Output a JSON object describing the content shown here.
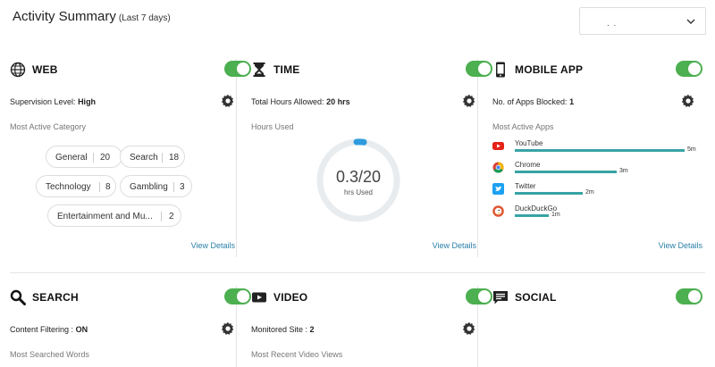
{
  "header": {
    "title": "Activity Summary",
    "subtitle": "(Last 7 days)",
    "dropdown_value": ". ."
  },
  "web": {
    "name": "WEB",
    "setting_label": "Supervision Level:",
    "setting_value": "High",
    "sublabel": "Most Active Category",
    "categories": [
      {
        "label": "General",
        "count": "20"
      },
      {
        "label": "Search",
        "count": "18"
      },
      {
        "label": "Technology",
        "count": "8"
      },
      {
        "label": "Gambling",
        "count": "3"
      },
      {
        "label": "Entertainment and Mu...",
        "count": "2"
      }
    ],
    "view": "View Details"
  },
  "time": {
    "name": "TIME",
    "setting_label": "Total Hours Allowed:",
    "setting_value": "20 hrs",
    "sublabel": "Hours Used",
    "used_value": "0.3/20",
    "used_unit": "hrs Used",
    "used_fraction": 0.015,
    "view": "View Details"
  },
  "mobile": {
    "name": "MOBILE APP",
    "setting_label": "No. of Apps Blocked:",
    "setting_value": "1",
    "sublabel": "Most Active Apps",
    "apps": [
      {
        "name": "YouTube",
        "duration": "5m",
        "minutes": 5,
        "icon": "youtube-icon",
        "color": "#e62117"
      },
      {
        "name": "Chrome",
        "duration": "3m",
        "minutes": 3,
        "icon": "chrome-icon",
        "color": "#4285f4"
      },
      {
        "name": "Twitter",
        "duration": "2m",
        "minutes": 2,
        "icon": "twitter-icon",
        "color": "#1da1f2"
      },
      {
        "name": "DuckDuckGo",
        "duration": "1m",
        "minutes": 1,
        "icon": "duckduckgo-icon",
        "color": "#de5833"
      }
    ],
    "view": "View Details"
  },
  "search": {
    "name": "SEARCH",
    "setting_label": "Content Filtering :",
    "setting_value": "ON",
    "sublabel": "Most Searched Words"
  },
  "video": {
    "name": "VIDEO",
    "setting_label": "Monitored Site :",
    "setting_value": "2",
    "sublabel": "Most Recent Video Views"
  },
  "social": {
    "name": "SOCIAL"
  },
  "colors": {
    "accent": "#4caf50",
    "link": "#2a7fa8",
    "bar": "#38a3a5",
    "ring": "#e8ecef",
    "ring_progress": "#2f9bde"
  }
}
